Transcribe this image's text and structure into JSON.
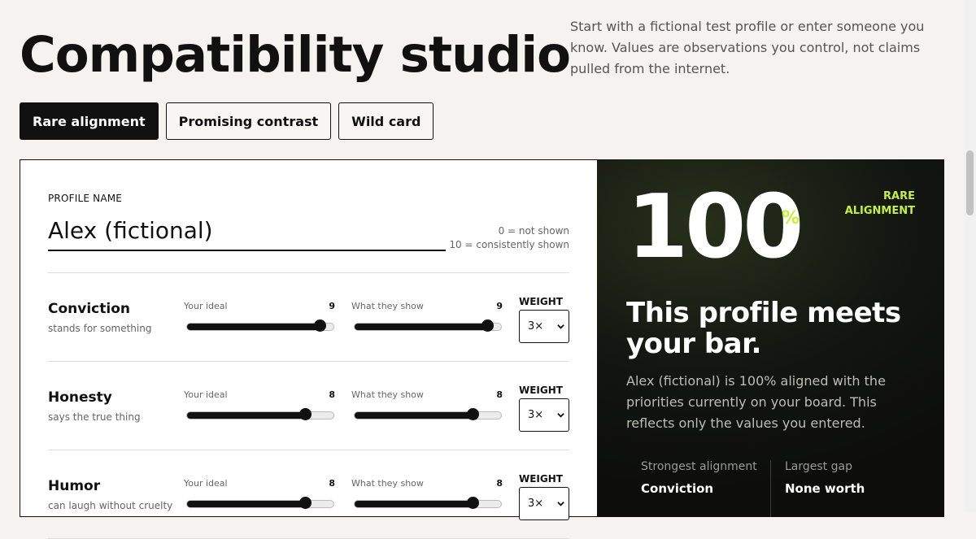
{
  "header": {
    "title": "Compatibility studio",
    "intro": "Start with a fictional test profile or enter someone you know. Values are observations you control, not claims pulled from the internet."
  },
  "presets": [
    {
      "label": "Rare alignment",
      "active": true
    },
    {
      "label": "Promising contrast",
      "active": false
    },
    {
      "label": "Wild card",
      "active": false
    }
  ],
  "profile": {
    "field_label": "PROFILE NAME",
    "name": "Alex (fictional)",
    "scale_min": "0 = not shown",
    "scale_max": "10 = consistently shown"
  },
  "slider_labels": {
    "ideal": "Your ideal",
    "shown": "What they show",
    "weight": "WEIGHT"
  },
  "values": [
    {
      "name": "Conviction",
      "desc": "stands for something",
      "ideal": 9,
      "shown": 9,
      "weight": "3×"
    },
    {
      "name": "Honesty",
      "desc": "says the true thing",
      "ideal": 8,
      "shown": 8,
      "weight": "3×"
    },
    {
      "name": "Humor",
      "desc": "can laugh without cruelty",
      "ideal": 8,
      "shown": 8,
      "weight": "3×"
    }
  ],
  "result": {
    "score": "100",
    "unit": "%",
    "verdict": "RARE ALIGNMENT",
    "headline": "This profile meets your bar.",
    "summary": "Alex (fictional) is 100% aligned with the priorities currently on your board. This reflects only the values you entered.",
    "strongest_label": "Strongest alignment",
    "strongest_value": "Conviction",
    "gap_label": "Largest gap",
    "gap_value": "None worth"
  },
  "colors": {
    "accent": "#c6f035",
    "ink": "#111111",
    "background": "#f4f3ef"
  }
}
